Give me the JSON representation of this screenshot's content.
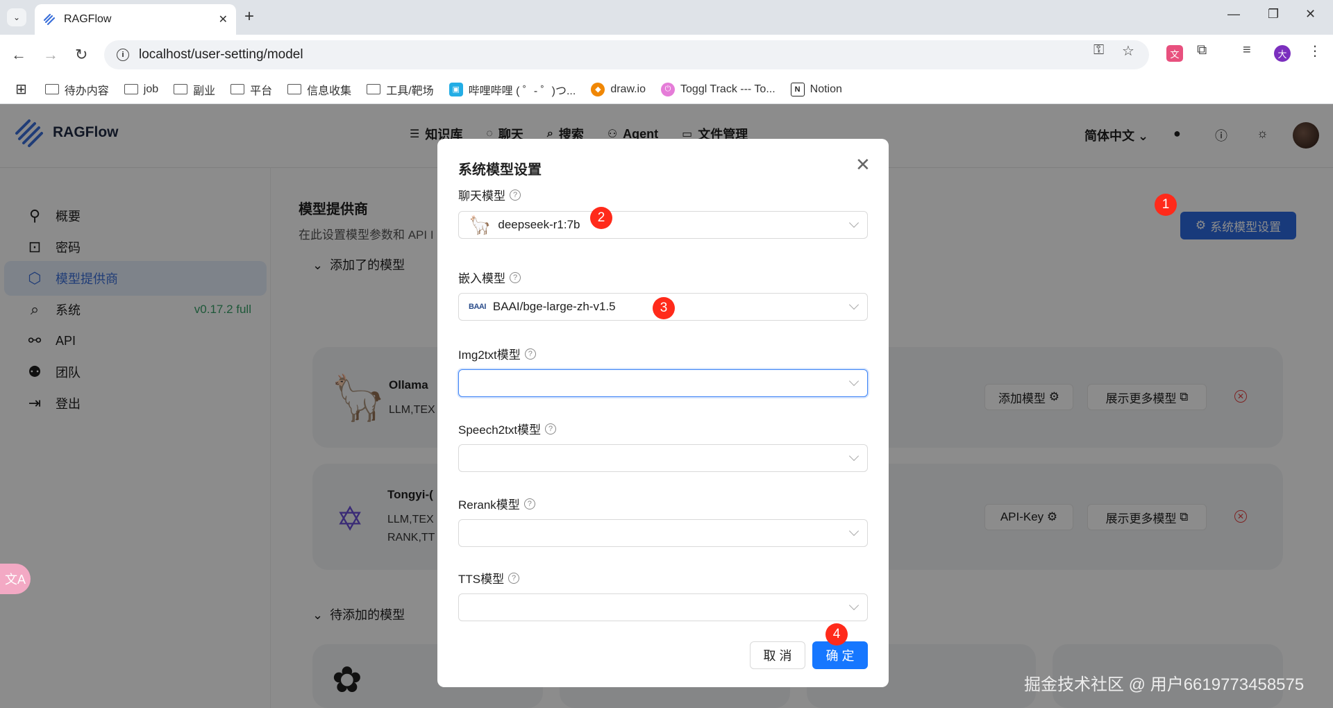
{
  "browser": {
    "tab_title": "RAGFlow",
    "url": "localhost/user-setting/model",
    "bookmarks": [
      "待办内容",
      "job",
      "副业",
      "平台",
      "信息收集",
      "工具/靶场",
      "哔哩哔哩 ( ゜- ゜)つ...",
      "draw.io",
      "Toggl Track --- To...",
      "Notion"
    ]
  },
  "app": {
    "name": "RAGFlow",
    "nav": [
      "知识库",
      "聊天",
      "搜索",
      "Agent",
      "文件管理"
    ],
    "language": "简体中文",
    "sidebar": [
      {
        "label": "概要",
        "icon": "user-icon"
      },
      {
        "label": "密码",
        "icon": "lock-icon"
      },
      {
        "label": "模型提供商",
        "icon": "model-icon"
      },
      {
        "label": "系统",
        "icon": "system-icon",
        "version": "v0.17.2 full"
      },
      {
        "label": "API",
        "icon": "api-icon"
      },
      {
        "label": "团队",
        "icon": "team-icon"
      },
      {
        "label": "登出",
        "icon": "logout-icon"
      }
    ],
    "main": {
      "title": "模型提供商",
      "subtitle": "在此设置模型参数和 API I",
      "system_button": "系统模型设置",
      "added_section": "添加了的模型",
      "pending_section": "待添加的模型",
      "cards": [
        {
          "name": "Ollama",
          "tags": "LLM,TEX",
          "btn1": "添加模型",
          "btn2": "展示更多模型"
        },
        {
          "name": "Tongyi-(",
          "tags": "LLM,TEX",
          "tags2": "RANK,TT",
          "btn1": "API-Key",
          "btn2": "展示更多模型"
        }
      ]
    }
  },
  "modal": {
    "title": "系统模型设置",
    "fields": [
      {
        "label": "聊天模型",
        "value": "deepseek-r1:7b"
      },
      {
        "label": "嵌入模型",
        "value": "BAAI/bge-large-zh-v1.5"
      },
      {
        "label": "Img2txt模型",
        "value": ""
      },
      {
        "label": "Speech2txt模型",
        "value": ""
      },
      {
        "label": "Rerank模型",
        "value": ""
      },
      {
        "label": "TTS模型",
        "value": ""
      }
    ],
    "cancel": "取 消",
    "ok": "确 定"
  },
  "annotations": [
    "1",
    "2",
    "3",
    "4"
  ],
  "watermark": "掘金技术社区 @ 用户6619773458575",
  "colors": {
    "primary": "#1677ff",
    "accent": "#2d6be0",
    "annotation": "#ff2a1a",
    "version": "#38a169"
  }
}
